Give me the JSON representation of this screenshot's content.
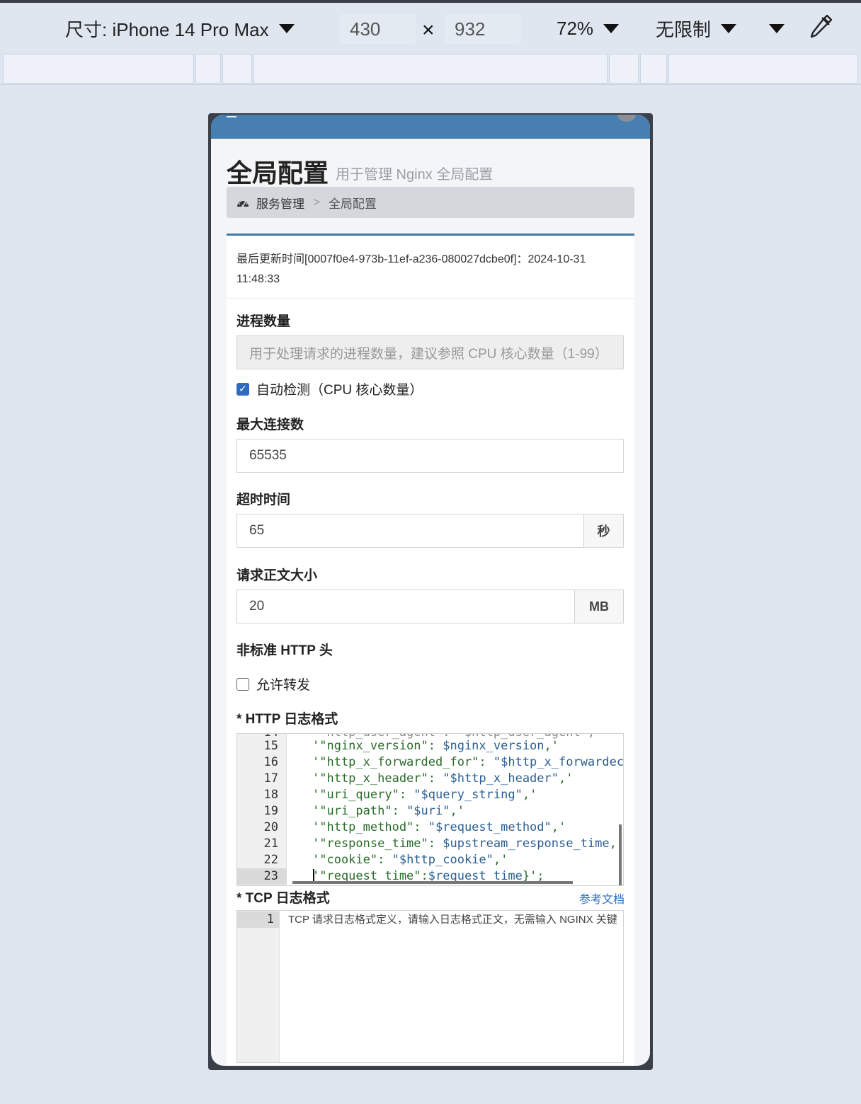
{
  "devtools": {
    "device_label": "尺寸: iPhone 14 Pro Max",
    "width": "430",
    "times": "×",
    "height": "932",
    "zoom": "72%",
    "throttle": "无限制",
    "icons": [
      "caret-down-icon",
      "eyedropper-icon"
    ]
  },
  "page": {
    "title": "全局配置",
    "subtitle": "用于管理 Nginx 全局配置"
  },
  "breadcrumb": {
    "icon": "dashboard-icon",
    "parent": "服务管理",
    "separator": ">",
    "current": "全局配置"
  },
  "meta": {
    "last_updated": "最后更新时间[0007f0e4-973b-11ef-a236-080027dcbe0f]：2024-10-31 11:48:33"
  },
  "form": {
    "workers": {
      "label": "进程数量",
      "placeholder": "用于处理请求的进程数量，建议参照 CPU 核心数量（1-99）",
      "auto_detect_label": "自动检测（CPU 核心数量）",
      "auto_detect_checked": true
    },
    "max_connections": {
      "label": "最大连接数",
      "value": "65535"
    },
    "timeout": {
      "label": "超时时间",
      "value": "65",
      "unit": "秒"
    },
    "body_size": {
      "label": "请求正文大小",
      "value": "20",
      "unit": "MB"
    },
    "nonstandard_headers": {
      "label": "非标准 HTTP 头",
      "allow_label": "允许转发",
      "allow_checked": false
    },
    "http_log_format": {
      "label": "* HTTP 日志格式",
      "active_line": 23,
      "lines": [
        {
          "n": "15",
          "key": "'\"nginx_version\": ",
          "val": "$nginx_version",
          "tail": ",'"
        },
        {
          "n": "16",
          "key": "'\"http_x_forwarded_for\": ",
          "val": "\"$http_x_forwardec",
          "tail": ""
        },
        {
          "n": "17",
          "key": "'\"http_x_header\": ",
          "val": "\"$http_x_header\"",
          "tail": ",'"
        },
        {
          "n": "18",
          "key": "'\"uri_query\": ",
          "val": "\"$query_string\"",
          "tail": ",'"
        },
        {
          "n": "19",
          "key": "'\"uri_path\": ",
          "val": "\"$uri\"",
          "tail": ",'"
        },
        {
          "n": "20",
          "key": "'\"http_method\": ",
          "val": "\"$request_method\"",
          "tail": ",'"
        },
        {
          "n": "21",
          "key": "'\"response_time\": ",
          "val": "$upstream_response_time",
          "tail": ","
        },
        {
          "n": "22",
          "key": "'\"cookie\": ",
          "val": "\"$http_cookie\"",
          "tail": ",'"
        },
        {
          "n": "23",
          "key": "'\"request_time\":",
          "val": "$request_time",
          "tail": "}';"
        }
      ]
    },
    "tcp_log_format": {
      "label": "* TCP 日志格式",
      "ref_link": "参考文档",
      "line_number": "1",
      "placeholder": "TCP 请求日志格式定义，请输入日志格式正文，无需输入 NGINX 关键"
    }
  }
}
